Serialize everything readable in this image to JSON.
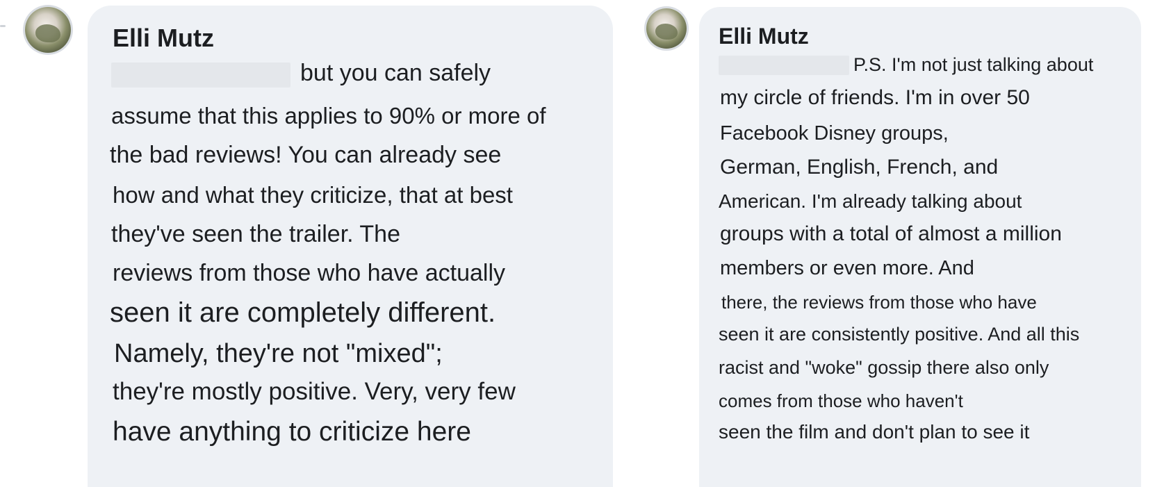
{
  "left_comment": {
    "author": "Elli Mutz",
    "lines": [
      "but you can safely",
      "assume that this applies to 90% or more of",
      "the bad reviews! You can already see",
      "how and what they criticize, that at best",
      "they've seen the trailer. The",
      "reviews from those who have actually",
      "seen it are completely different.",
      "Namely, they're not \"mixed\";",
      "they're mostly positive. Very, very few",
      "have anything to criticize here"
    ]
  },
  "right_comment": {
    "author": "Elli Mutz",
    "lines": [
      "P.S. I'm not just talking about",
      "my circle of friends. I'm in over 50",
      "Facebook Disney groups,",
      "German, English, French, and",
      "American. I'm already talking about",
      "groups with a total of almost a million",
      "members or even more. And",
      "there, the reviews from those who have",
      "seen it are consistently positive. And all this",
      "racist and \"woke\" gossip there also only",
      "comes from those who haven't",
      "seen the film and don't plan to see it"
    ]
  },
  "colors": {
    "bubble": "#eef1f5",
    "text": "#1c1e21",
    "redaction": "#e4e7eb"
  }
}
